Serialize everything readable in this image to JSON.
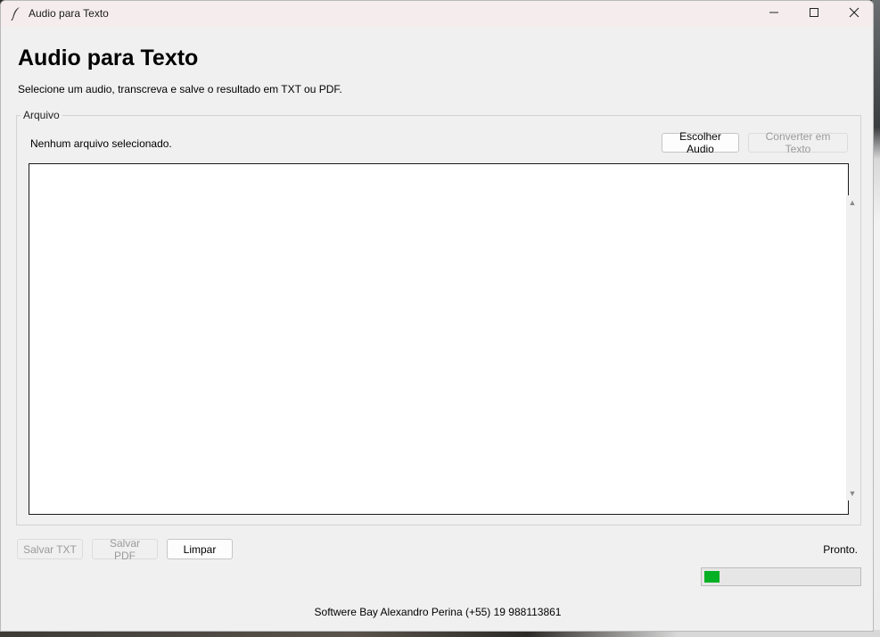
{
  "window": {
    "title": "Audio para Texto",
    "icon": "feather-icon",
    "controls": [
      "minimize-icon",
      "maximize-icon",
      "close-icon"
    ]
  },
  "header": {
    "title": "Audio para Texto",
    "subtitle": "Selecione um audio, transcreva e salve o resultado em TXT ou PDF."
  },
  "file_section": {
    "legend": "Arquivo",
    "status": "Nenhum arquivo selecionado.",
    "choose_label": "Escolher Audio",
    "convert_label": "Converter em Texto",
    "convert_enabled": false,
    "transcript": ""
  },
  "actions": {
    "save_txt_label": "Salvar TXT",
    "save_pdf_label": "Salvar PDF",
    "clear_label": "Limpar",
    "save_enabled": false
  },
  "status": {
    "text": "Pronto.",
    "progress_fraction": 0.1,
    "progress_color": "#06b025"
  },
  "footer": {
    "text": "Softwere Bay Alexandro Perina (+55) 19 988113861"
  }
}
